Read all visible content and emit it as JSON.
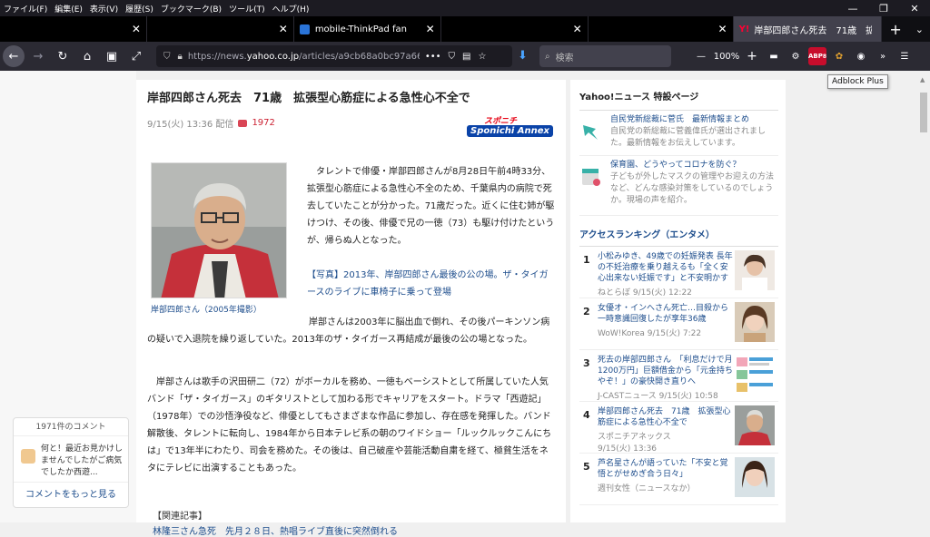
{
  "menu": [
    "ファイル(F)",
    "編集(E)",
    "表示(V)",
    "履歴(S)",
    "ブックマーク(B)",
    "ツール(T)",
    "ヘルプ(H)"
  ],
  "window_controls": {
    "minimize": "—",
    "restore": "❐",
    "close": "✕"
  },
  "tabs": [
    {
      "title": ""
    },
    {
      "title": ""
    },
    {
      "title": "mobile-ThinkPad fan"
    },
    {
      "title": ""
    },
    {
      "title": ""
    },
    {
      "title": "岸部四郎さん死去　71歳　拡"
    }
  ],
  "toolbar": {
    "url_prefix": "https://news.",
    "url_domain": "yahoo.co.jp",
    "url_rest": "/articles/a9cb68a0bc97a66857",
    "search_placeholder": "検索",
    "zoom": "100%",
    "abp_badge": "8",
    "tooltip": "Adblock Plus"
  },
  "article": {
    "headline": "岸部四郎さん死去　71歳　拡張型心筋症による急性心不全で",
    "date": "9/15(火) 13:36 配信",
    "comment_count": "1972",
    "source_logo_top": "スポニチ",
    "source_logo_bottom": "Sponichi Annex",
    "photo_caption": "岸部四郎さん（2005年撮影）",
    "lead": "タレントで俳優・岸部四郎さんが8月28日午前4時33分、拡張型心筋症による急性心不全のため、千葉県内の病院で死去していたことが分かった。71歳だった。近くに住む姉が駆けつけ、その後、俳優で兄の一徳（73）も駆け付けたというが、帰らぬ人となった。",
    "photo_link": "【写真】2013年、岸部四郎さん最後の公の場。ザ・タイガースのライブに車椅子に乗って登場",
    "para2": "岸部さんは2003年に脳出血で倒れ、その後パーキンソン病の疑いで入退院を繰り返していた。2013年のザ・タイガース再結成が最後の公の場となった。",
    "para3": "岸部さんは歌手の沢田研二（72）がボーカルを務め、一徳もベーシストとして所属していた人気バンド「ザ・タイガース」のギタリストとして加わる形でキャリアをスタート。ドラマ「西遊記」（1978年）での沙悟浄役など、俳優としてもさまざまな作品に参加し、存在感を発揮した。バンド解散後、タレントに転向し、1984年から日本テレビ系の朝のワイドショー「ルックルックこんにちは」で13年半にわたり、司会を務めた。その後は、自己破産や芸能活動自粛を経て、極貧生活をネタにテレビに出演することもあった。",
    "related_head": "【関連記事】",
    "related_link": "林隆三さん急死　先月２８日、熱唱ライブ直後に突然倒れる"
  },
  "comments_widget": {
    "title": "1971件のコメント",
    "preview": "何と！最近お見かけしませんでしたがご病気でしたか西遊...",
    "more": "コメントをもっと見る"
  },
  "sidebar": {
    "special_title": "Yahoo!ニュース 特設ページ",
    "special": [
      {
        "title": "自民党新総裁に菅氏　最新情報まとめ",
        "desc": "自民党の新総裁に菅義偉氏が選出されました。最新情報をお伝えしています。",
        "icon": "map-pin-icon"
      },
      {
        "title": "保育園、どうやってコロナを防ぐ？",
        "desc": "子どもが外したマスクの管理やお迎えの方法など、どんな感染対策をしているのでしょうか。現場の声を紹介。",
        "icon": "calendar-icon"
      }
    ],
    "ranking_title": "アクセスランキング（エンタメ）",
    "ranking": [
      {
        "num": "1",
        "title": "小松みゆき、49歳での妊娠発表 長年の不妊治療を乗り越えるも「全く安心出来ない妊娠です」と不安明かす",
        "src": "ねとらぼ 9/15(火) 12:22"
      },
      {
        "num": "2",
        "title": "女優オ・インへさん死亡…目殺から一時意識回復したが享年36歳",
        "src": "WoW!Korea 9/15(火) 7:22"
      },
      {
        "num": "3",
        "title": "死去の岸部四郎さん　「利息だけで月1200万円」巨額借金から「元金持ちやぞ！」の豪快開き直りへ",
        "src": "J-CASTニュース 9/15(火) 10:58"
      },
      {
        "num": "4",
        "title": "岸部四郎さん死去　71歳　拡張型心筋症による急性心不全で",
        "src": "スポニチアネックス\n9/15(火) 13:36"
      },
      {
        "num": "5",
        "title": "芦名星さんが語っていた「不安と覚悟とがせめぎ合う日々」",
        "src": "週刊女性（ニュースなか）"
      }
    ]
  }
}
